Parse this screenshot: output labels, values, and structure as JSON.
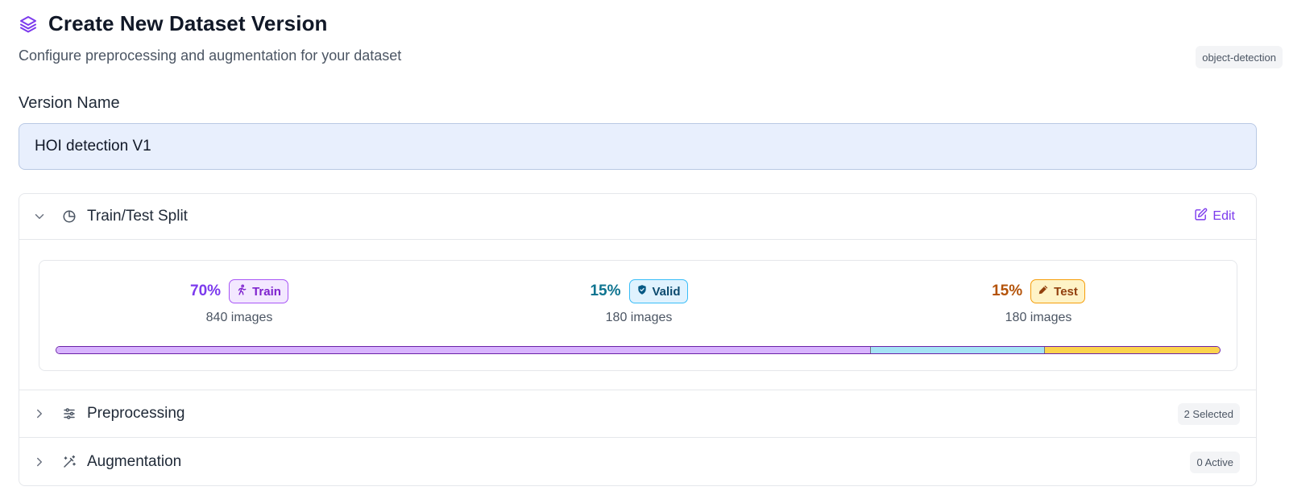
{
  "header": {
    "title": "Create New Dataset Version",
    "subtitle": "Configure preprocessing and augmentation for your dataset",
    "project_type": "object-detection",
    "icon": "layers-icon"
  },
  "version_name": {
    "label": "Version Name",
    "value": "HOI detection V1"
  },
  "sections": {
    "split": {
      "title": "Train/Test Split",
      "edit_label": "Edit",
      "expanded": true,
      "train": {
        "percent": "70%",
        "label": "Train",
        "count": "840 images",
        "fraction": 0.7,
        "color": "#d8b4fe"
      },
      "valid": {
        "percent": "15%",
        "label": "Valid",
        "count": "180 images",
        "fraction": 0.15,
        "color": "#a5e3f5"
      },
      "test": {
        "percent": "15%",
        "label": "Test",
        "count": "180 images",
        "fraction": 0.15,
        "color": "#fcd34d"
      }
    },
    "preprocessing": {
      "title": "Preprocessing",
      "badge": "2 Selected",
      "expanded": false
    },
    "augmentation": {
      "title": "Augmentation",
      "badge": "0 Active",
      "expanded": false
    }
  },
  "colors": {
    "accent": "#7c3aed",
    "input_bg": "#e8effd"
  }
}
